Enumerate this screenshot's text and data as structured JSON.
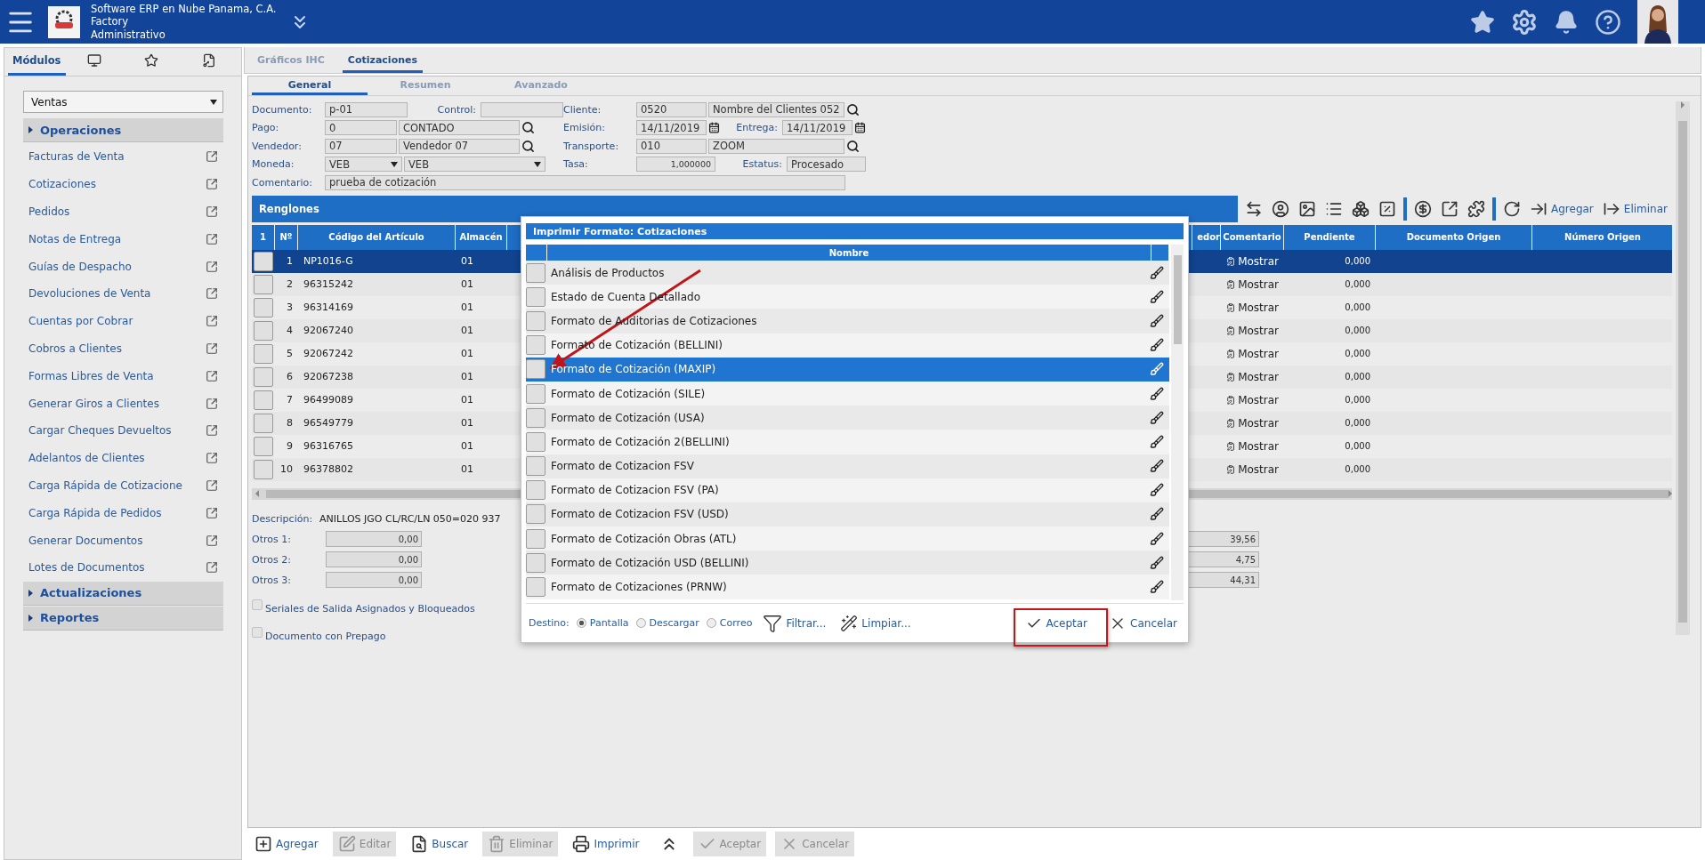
{
  "header": {
    "company": "Software ERP en Nube Panama, C.A.",
    "site": "Factory",
    "role": "Administrativo"
  },
  "sidebar": {
    "tabs": [
      {
        "kind": "text",
        "label": "Módulos",
        "selected": true
      },
      {
        "kind": "monitor",
        "selected": false
      },
      {
        "kind": "star",
        "selected": false
      },
      {
        "kind": "document",
        "selected": false
      }
    ],
    "module": "Ventas",
    "sections": [
      {
        "title": "Operaciones",
        "items": [
          "Facturas de Venta",
          "Cotizaciones",
          "Pedidos",
          "Notas de Entrega",
          "Guías de Despacho",
          "Devoluciones de Venta",
          "Cuentas por Cobrar",
          "Cobros a Clientes",
          "Formas Libres de Venta",
          "Generar Giros a Clientes",
          "Cargar Cheques Devueltos",
          "Adelantos de Clientes",
          "Carga Rápida de Cotizacione",
          "Carga Rápida de Pedidos",
          "Generar Documentos",
          "Lotes de Documentos"
        ]
      },
      {
        "title": "Actualizaciones"
      },
      {
        "title": "Reportes"
      }
    ]
  },
  "main_tabs": [
    {
      "label": "Gráficos IHC",
      "selected": false
    },
    {
      "label": "Cotizaciones",
      "selected": true
    }
  ],
  "sub_tabs": [
    {
      "label": "General",
      "selected": true
    },
    {
      "label": "Resumen",
      "selected": false
    },
    {
      "label": "Avanzado",
      "selected": false
    }
  ],
  "form": {
    "left": [
      [
        {
          "kind": "label",
          "text": "Documento:"
        },
        {
          "kind": "doc",
          "text": "p-01"
        },
        {
          "kind": "label_mid",
          "text": "Control:"
        },
        {
          "kind": "doc"
        }
      ],
      [
        {
          "kind": "label",
          "text": "Pago:"
        },
        {
          "kind": "code",
          "text": "0"
        },
        {
          "kind": "name",
          "text": "CONTADO"
        },
        {
          "kind": "search"
        }
      ],
      [
        {
          "kind": "label",
          "text": "Vendedor:"
        },
        {
          "kind": "code",
          "text": "07"
        },
        {
          "kind": "name",
          "text": "Vendedor 07"
        },
        {
          "kind": "search"
        }
      ],
      [
        {
          "kind": "label",
          "text": "Moneda:"
        },
        {
          "kind": "select_short",
          "text": "VEB"
        },
        {
          "kind": "select_long",
          "text": "VEB"
        }
      ]
    ],
    "right": [
      [
        {
          "kind": "label",
          "text": "Cliente:"
        },
        {
          "kind": "date",
          "text": "0520"
        },
        {
          "kind": "name_wide",
          "text": "Nombre del Clientes 052"
        },
        {
          "kind": "search"
        }
      ],
      [
        {
          "kind": "label",
          "text": "Emisión:"
        },
        {
          "kind": "date",
          "text": "14/11/2019"
        },
        {
          "kind": "calendar"
        },
        {
          "kind": "label_mid",
          "text": "Entrega:"
        },
        {
          "kind": "date",
          "text": "14/11/2019"
        },
        {
          "kind": "calendar"
        }
      ],
      [
        {
          "kind": "label",
          "text": "Transporte:"
        },
        {
          "kind": "date",
          "text": "010"
        },
        {
          "kind": "name_wide",
          "text": "ZOOM"
        },
        {
          "kind": "search"
        }
      ],
      [
        {
          "kind": "label",
          "text": "Tasa:"
        },
        {
          "kind": "number",
          "text": "1,000000"
        },
        {
          "kind": "label_mid",
          "text": "Estatus:"
        },
        {
          "kind": "status",
          "text": "Procesado"
        }
      ]
    ],
    "comment": {
      "label": "Comentario:",
      "value": "prueba de cotización"
    }
  },
  "lines": {
    "title": "Renglones",
    "toolbar": [
      {
        "kind": "arrows"
      },
      {
        "kind": "user"
      },
      {
        "kind": "image"
      },
      {
        "kind": "list"
      },
      {
        "kind": "boxes"
      },
      {
        "kind": "percent"
      },
      {
        "kind": "divider"
      },
      {
        "kind": "dollar"
      },
      {
        "kind": "external"
      },
      {
        "kind": "puzzle"
      },
      {
        "kind": "divider"
      },
      {
        "kind": "refresh"
      },
      {
        "kind": "add",
        "label": "Agregar"
      },
      {
        "kind": "remove",
        "label": "Eliminar"
      }
    ],
    "columns": [
      "1",
      "Nº",
      "Código del Artículo",
      "Almacén",
      "edor",
      "Comentario",
      "Pendiente",
      "Documento Origen",
      "Número Origen"
    ],
    "rows": [
      {
        "n": "1",
        "code": "NP1016-G",
        "store": "01",
        "comment": "Mostrar",
        "pending": "0,000",
        "selected": true
      },
      {
        "n": "2",
        "code": "96315242",
        "store": "01",
        "comment": "Mostrar",
        "pending": "0,000",
        "selected": false
      },
      {
        "n": "3",
        "code": "96314169",
        "store": "01",
        "comment": "Mostrar",
        "pending": "0,000",
        "selected": false
      },
      {
        "n": "4",
        "code": "92067240",
        "store": "01",
        "comment": "Mostrar",
        "pending": "0,000",
        "selected": false
      },
      {
        "n": "5",
        "code": "92067242",
        "store": "01",
        "comment": "Mostrar",
        "pending": "0,000",
        "selected": false
      },
      {
        "n": "6",
        "code": "92067238",
        "store": "01",
        "comment": "Mostrar",
        "pending": "0,000",
        "selected": false
      },
      {
        "n": "7",
        "code": "96499089",
        "store": "01",
        "comment": "Mostrar",
        "pending": "0,000",
        "selected": false
      },
      {
        "n": "8",
        "code": "96549779",
        "store": "01",
        "comment": "Mostrar",
        "pending": "0,000",
        "selected": false
      },
      {
        "n": "9",
        "code": "96316765",
        "store": "01",
        "comment": "Mostrar",
        "pending": "0,000",
        "selected": false
      },
      {
        "n": "10",
        "code": "96378802",
        "store": "01",
        "comment": "Mostrar",
        "pending": "0,000",
        "selected": false
      }
    ]
  },
  "details": {
    "description_label": "Descripción:",
    "description": "ANILLOS JGO CL/RC/LN 050=020 937",
    "others": [
      {
        "label": "Otros 1:",
        "value": "0,00",
        "total": "39,56"
      },
      {
        "label": "Otros 2:",
        "value": "0,00",
        "total": "4,75"
      },
      {
        "label": "Otros 3:",
        "value": "0,00",
        "total": "44,31"
      }
    ],
    "checks": [
      {
        "label": "Seriales de Salida Asignados y Bloqueados",
        "checked": false
      },
      {
        "label": "Documento con Prepago",
        "checked": false
      }
    ]
  },
  "bottom_toolbar": [
    {
      "kind": "add",
      "label": "Agregar",
      "disabled": false
    },
    {
      "kind": "edit",
      "label": "Editar",
      "disabled": true
    },
    {
      "kind": "search",
      "label": "Buscar",
      "disabled": false
    },
    {
      "kind": "delete",
      "label": "Eliminar",
      "disabled": true
    },
    {
      "kind": "print",
      "label": "Imprimir",
      "disabled": false
    },
    {
      "kind": "collapse",
      "disabled": false
    },
    {
      "kind": "accept",
      "label": "Aceptar",
      "disabled": true
    },
    {
      "kind": "cancel",
      "label": "Cancelar",
      "disabled": true
    }
  ],
  "dialog": {
    "title": "Imprimir Formato: Cotizaciones",
    "column": "Nombre",
    "rows": [
      {
        "name": "Análisis de Productos",
        "selected": false
      },
      {
        "name": "Estado de Cuenta Detallado",
        "selected": false
      },
      {
        "name": "Formato de Auditorias de Cotizaciones",
        "selected": false
      },
      {
        "name": "Formato de Cotización (BELLINI)",
        "selected": false
      },
      {
        "name": "Formato de Cotización (MAXIP)",
        "selected": true
      },
      {
        "name": "Formato de Cotización (SILE)",
        "selected": false
      },
      {
        "name": "Formato de Cotización (USA)",
        "selected": false
      },
      {
        "name": "Formato de Cotización 2(BELLINI)",
        "selected": false
      },
      {
        "name": "Formato de Cotizacion FSV",
        "selected": false
      },
      {
        "name": "Formato de Cotizacion FSV (PA)",
        "selected": false
      },
      {
        "name": "Formato de Cotizacion FSV (USD)",
        "selected": false
      },
      {
        "name": "Formato de Cotización Obras (ATL)",
        "selected": false
      },
      {
        "name": "Formato de Cotización USD (BELLINI)",
        "selected": false
      },
      {
        "name": "Formato de Cotizaciones (PRNW)",
        "selected": false
      }
    ],
    "destination_label": "Destino:",
    "destinations": [
      {
        "label": "Pantalla",
        "selected": true
      },
      {
        "label": "Descargar",
        "selected": false
      },
      {
        "label": "Correo",
        "selected": false
      }
    ],
    "filter": "Filtrar...",
    "clear": "Limpiar...",
    "accept": "Aceptar",
    "cancel": "Cancelar"
  }
}
